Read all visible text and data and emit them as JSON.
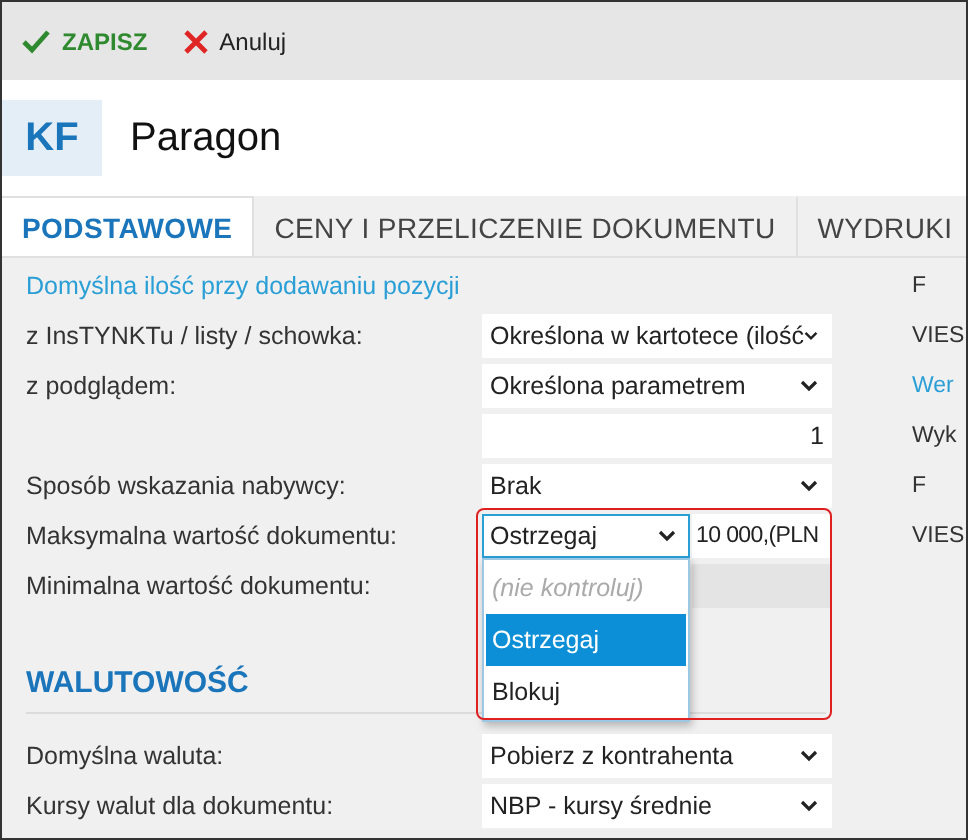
{
  "toolbar": {
    "buttons": [
      {
        "kind": "save",
        "label": "ZAPISZ"
      },
      {
        "kind": "cancel",
        "label": "Anuluj"
      }
    ]
  },
  "header": {
    "badge": "KF",
    "title": "Paragon"
  },
  "tabs": [
    {
      "label": "PODSTAWOWE",
      "selected": true
    },
    {
      "label": "CENY I PRZELICZENIE DOKUMENTU",
      "selected": false
    },
    {
      "label": "WYDRUKI",
      "selected": false
    }
  ],
  "sections": [
    {
      "kind": "link",
      "heading": "Domyślna ilość przy dodawaniu pozycji",
      "side": {
        "text": "F"
      },
      "rows": [
        {
          "label": "z InsTYNKTu / listy / schowka:",
          "field": {
            "kind": "select",
            "value": "Określona w kartotece (ilość"
          },
          "side": {
            "kind": "label",
            "text": "VIES"
          }
        },
        {
          "label": "z podglądem:",
          "field": {
            "kind": "select",
            "value": "Określona parametrem"
          },
          "side": {
            "kind": "link",
            "text": "Wer"
          }
        },
        {
          "field": {
            "kind": "number",
            "value": "1"
          },
          "side": {
            "kind": "label",
            "text": "Wyk"
          }
        },
        {
          "label": "Sposób wskazania nabywcy:",
          "field": {
            "kind": "select",
            "value": "Brak"
          },
          "side": {
            "kind": "label",
            "text": "F"
          }
        },
        {
          "label": "Maksymalna wartość dokumentu:",
          "field": {
            "kind": "select-amount",
            "value": "Ostrzegaj",
            "amount": "10 000,(PLN",
            "expanded": true,
            "highlighted": true,
            "options": [
              {
                "kind": "empty",
                "label": "(nie kontroluj)",
                "selected": false
              },
              {
                "kind": "item",
                "label": "Ostrzegaj",
                "selected": true
              },
              {
                "kind": "item",
                "label": "Blokuj",
                "selected": false
              }
            ]
          },
          "side": {
            "kind": "label",
            "text": "VIES"
          }
        },
        {
          "label": "Minimalna wartość dokumentu:",
          "field": {
            "kind": "disabled-amount"
          }
        }
      ]
    },
    {
      "kind": "title",
      "heading": "WALUTOWOŚĆ",
      "rows": [
        {
          "label": "Domyślna waluta:",
          "field": {
            "kind": "select",
            "value": "Pobierz z kontrahenta"
          }
        },
        {
          "label": "Kursy walut dla dokumentu:",
          "field": {
            "kind": "select",
            "value": "NBP - kursy średnie"
          }
        }
      ]
    }
  ]
}
